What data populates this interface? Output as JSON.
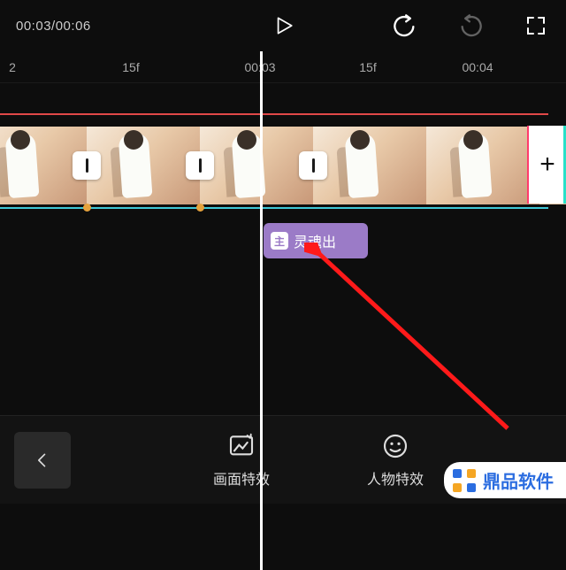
{
  "playback": {
    "current_time": "00:03",
    "total_time": "00:06"
  },
  "ruler": {
    "ticks": [
      {
        "label": "2",
        "px": 14
      },
      {
        "label": "15f",
        "px": 148
      },
      {
        "label": "00:03",
        "px": 300
      },
      {
        "label": "15f",
        "px": 416
      },
      {
        "label": "00:04",
        "px": 540
      }
    ]
  },
  "effect": {
    "badge": "主",
    "name": "灵魂出"
  },
  "tabs": {
    "visual_effects": "画面特效",
    "person_effects": "人物特效"
  },
  "icons": {
    "play": "play",
    "undo": "undo",
    "redo": "redo",
    "fullscreen": "fullscreen",
    "back": "back",
    "image_fx": "image-fx",
    "face_fx": "face-fx",
    "add": "+"
  },
  "watermark": "鼎品软件"
}
